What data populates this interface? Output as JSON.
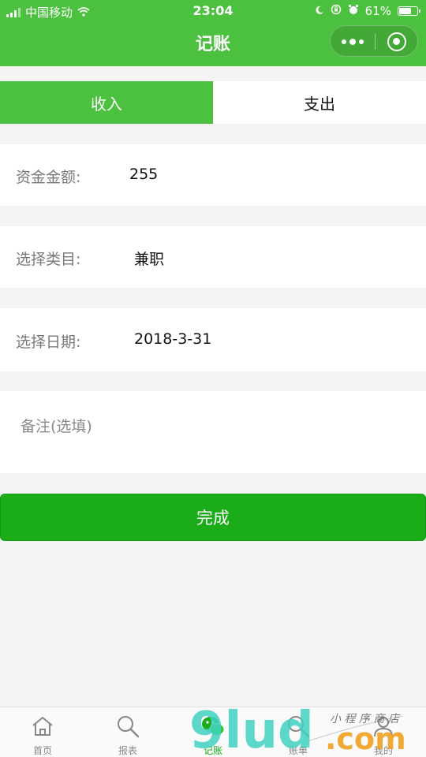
{
  "status_bar": {
    "carrier": "中国移动",
    "time": "23:04",
    "battery_text": "61%",
    "battery_level": 0.61
  },
  "nav": {
    "title": "记账"
  },
  "tabs": [
    {
      "label": "收入",
      "active": true
    },
    {
      "label": "支出",
      "active": false
    }
  ],
  "form": {
    "amount_label": "资金金额:",
    "amount_value": "255",
    "category_label": "选择类目:",
    "category_value": "兼职",
    "date_label": "选择日期:",
    "date_value": "2018-3-31",
    "note_placeholder": "备注(选填)"
  },
  "done_button": "完成",
  "tabbar": [
    {
      "label": "首页",
      "icon": "home-icon"
    },
    {
      "label": "报表",
      "icon": "search-icon"
    },
    {
      "label": "记账",
      "icon": "chat-icon",
      "active": true
    },
    {
      "label": "账单",
      "icon": "search-icon"
    },
    {
      "label": "我的",
      "icon": "user-icon"
    }
  ],
  "watermark": {
    "text": "9lud.com",
    "tagline": "小程序商店"
  },
  "colors": {
    "theme_green": "#4cc13f",
    "button_green": "#1aad19",
    "background": "#f4f4f4"
  }
}
